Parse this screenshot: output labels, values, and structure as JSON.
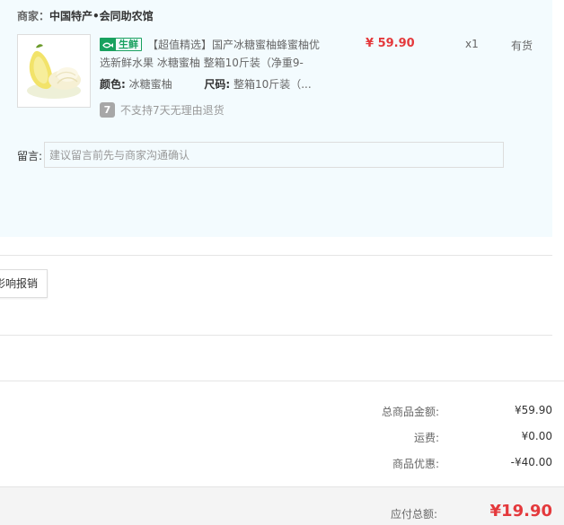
{
  "shop": {
    "label": "商家：",
    "name": "中国特产•会同助农馆"
  },
  "item": {
    "fresh_tag": "生鲜",
    "title": "【超值精选】国产冰糖蜜柚蜂蜜柚优选新鲜水果 冰糖蜜柚 整箱10斤装（净重9-",
    "color_key": "颜色:",
    "color_val": "冰糖蜜柚",
    "size_key": "尺码:",
    "size_val": "整箱10斤装（...",
    "no_return_icon": "7",
    "no_return": "不支持7天无理由退货",
    "price": "¥ 59.90",
    "qty": "x1",
    "stock": "有货"
  },
  "remark": {
    "label": "留言:",
    "placeholder": "建议留言前先与商家沟通确认"
  },
  "reimburse": {
    "label": "影响报销"
  },
  "summary": [
    {
      "key": "总商品金额:",
      "val": "¥59.90"
    },
    {
      "key": "运费:",
      "val": "¥0.00"
    },
    {
      "key": "商品优惠:",
      "val": "-¥40.00"
    }
  ],
  "total": {
    "key": "应付总额:",
    "val": "¥19.90"
  },
  "colors": {
    "accent_red": "#e4393c",
    "fresh_green": "#19a15f",
    "shop_bg": "#f3fbfe"
  }
}
